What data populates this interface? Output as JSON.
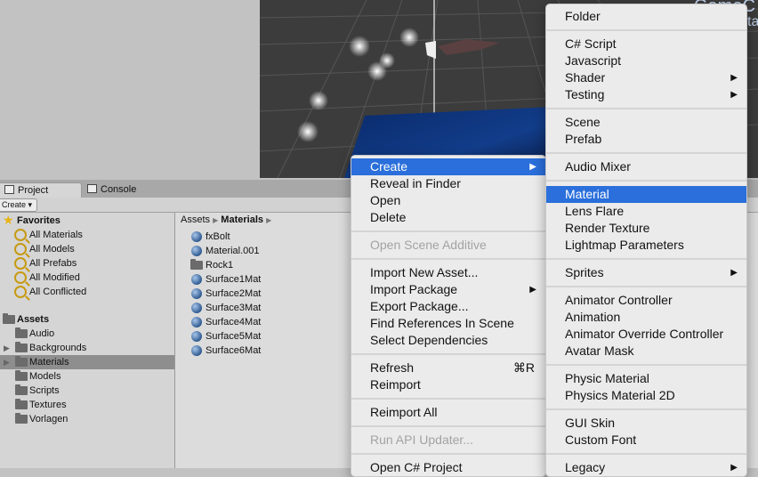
{
  "tabs": {
    "project": "Project",
    "console": "Console"
  },
  "toolbar": {
    "create": "Create"
  },
  "favorites": {
    "title": "Favorites",
    "items": [
      "All Materials",
      "All Models",
      "All Prefabs",
      "All Modified",
      "All Conflicted"
    ]
  },
  "assets_tree": {
    "title": "Assets",
    "items": [
      "Audio",
      "Backgrounds",
      "Materials",
      "Models",
      "Scripts",
      "Textures",
      "Vorlagen"
    ],
    "selected": "Materials"
  },
  "breadcrumb": {
    "root": "Assets",
    "current": "Materials"
  },
  "files": [
    "fxBolt",
    "Material.001",
    "Rock1",
    "Surface1Mat",
    "Surface2Mat",
    "Surface3Mat",
    "Surface4Mat",
    "Surface5Mat",
    "Surface6Mat"
  ],
  "context_menu": {
    "create": "Create",
    "reveal": "Reveal in Finder",
    "open": "Open",
    "delete": "Delete",
    "open_scene_additive": "Open Scene Additive",
    "import_new_asset": "Import New Asset...",
    "import_package": "Import Package",
    "export_package": "Export Package...",
    "find_references": "Find References In Scene",
    "select_dependencies": "Select Dependencies",
    "refresh": "Refresh",
    "refresh_shortcut": "⌘R",
    "reimport": "Reimport",
    "reimport_all": "Reimport All",
    "run_api_updater": "Run API Updater...",
    "open_cs_project": "Open C# Project"
  },
  "create_submenu": {
    "folder": "Folder",
    "cs_script": "C# Script",
    "javascript": "Javascript",
    "shader": "Shader",
    "testing": "Testing",
    "scene": "Scene",
    "prefab": "Prefab",
    "audio_mixer": "Audio Mixer",
    "material": "Material",
    "lens_flare": "Lens Flare",
    "render_texture": "Render Texture",
    "lightmap_parameters": "Lightmap Parameters",
    "sprites": "Sprites",
    "animator_controller": "Animator Controller",
    "animation": "Animation",
    "animator_override_controller": "Animator Override Controller",
    "avatar_mask": "Avatar Mask",
    "physic_material": "Physic Material",
    "physics_material_2d": "Physics Material 2D",
    "gui_skin": "GUI Skin",
    "custom_font": "Custom Font",
    "legacy": "Legacy"
  },
  "scene_overlay": {
    "line1": "GameC",
    "line2": "sta"
  },
  "colors": {
    "highlight": "#2a6fdb",
    "selection_row": "#8e8e8e",
    "scene_bg": "#3a3a3a"
  }
}
